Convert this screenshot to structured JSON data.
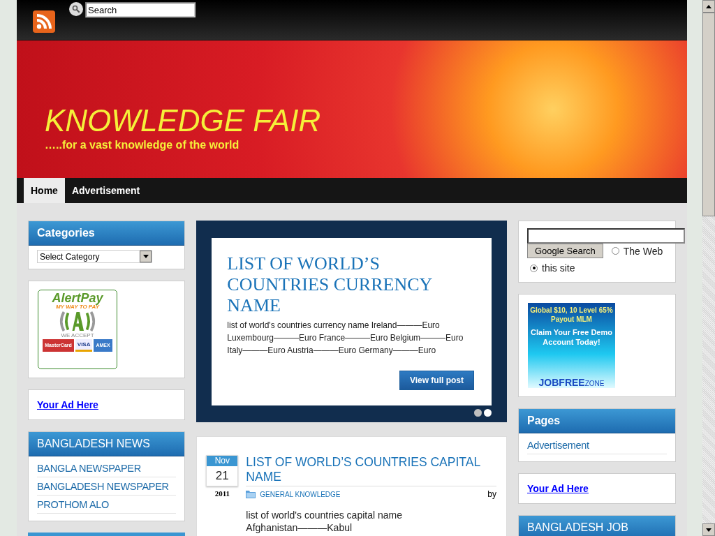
{
  "topbar": {
    "search_placeholder": "Search"
  },
  "header": {
    "title": "KNOWLEDGE FAIR",
    "tagline": "…..for a vast knowledge of the world"
  },
  "nav": [
    {
      "label": "Home",
      "selected": true
    },
    {
      "label": "Advertisement",
      "selected": false
    }
  ],
  "left_sidebar": {
    "categories": {
      "title": "Categories",
      "select_value": "Select Category"
    },
    "alertpay_banner": {
      "brand": "AlertPay",
      "slogan": "MY WAY TO PAY",
      "accept": "WE ACCEPT",
      "cards": [
        "MasterCard",
        "VISA",
        "AMEX"
      ]
    },
    "ad_link": "Your Ad Here",
    "news": {
      "title": "BANGLADESH NEWS",
      "items": [
        "BANGLA NEWSPAPER",
        "BANGLADESH NEWSPAPER",
        "PROTHOM ALO"
      ]
    }
  },
  "featured": {
    "title": "LIST OF WORLD’S COUNTRIES CURRENCY NAME",
    "excerpt": "list of world's countries currency name Ireland———Euro Luxembourg———Euro France———Euro Belgium———Euro Italy———Euro Austria———Euro Germany———Euro",
    "button": "View full post",
    "dots": [
      {
        "selected": false
      },
      {
        "selected": true
      }
    ]
  },
  "post": {
    "month": "Nov",
    "day": "21",
    "year": "2011",
    "title": "LIST OF WORLD’S COUNTRIES CAPITAL NAME",
    "category": "GENERAL KNOWLEDGE",
    "by": "by",
    "excerpt": "list of world's countries capital name Afghanistan———Kabul"
  },
  "right_sidebar": {
    "google": {
      "button": "Google Search",
      "options": [
        {
          "label": "The Web",
          "selected": false
        },
        {
          "label": "this site",
          "selected": true
        }
      ]
    },
    "mlm_banner": {
      "headline": "Global $10, 10 Level 65% Payout MLM",
      "offer": "Claim Your Free Demo Account Today!",
      "brand": "JOBFREE",
      "brand_suffix": "ZONE"
    },
    "pages": {
      "title": "Pages",
      "items": [
        "Advertisement"
      ]
    },
    "ad_link": "Your Ad Here",
    "job": {
      "title": "BANGLADESH JOB"
    }
  }
}
